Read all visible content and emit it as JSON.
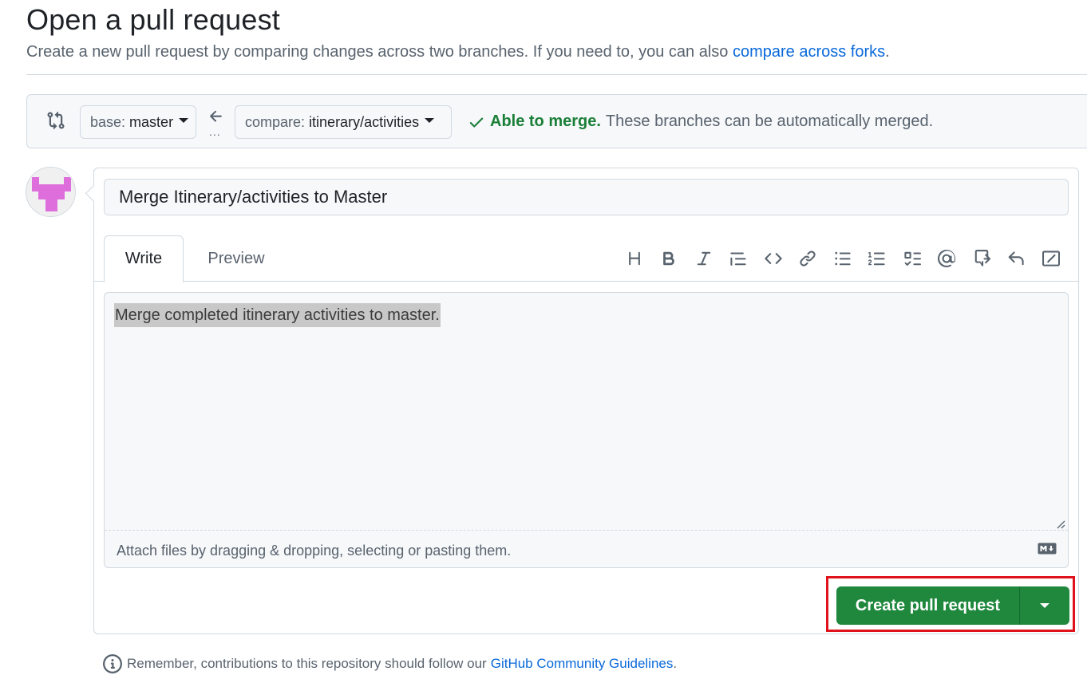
{
  "header": {
    "title": "Open a pull request",
    "subtitle_text": "Create a new pull request by comparing changes across two branches. If you need to, you can also",
    "subtitle_link": "compare across forks",
    "subtitle_end": "."
  },
  "range": {
    "base_prefix": "base:",
    "base_branch": "master",
    "compare_prefix": "compare:",
    "compare_branch": "itinerary/activities",
    "dots": "...",
    "merge_ok": "Able to merge.",
    "merge_note": "These branches can be automatically merged."
  },
  "form": {
    "title_value": "Merge Itinerary/activities to Master",
    "tabs": [
      {
        "label": "Write",
        "active": true
      },
      {
        "label": "Preview",
        "active": false
      }
    ],
    "toolbar_icons": [
      "heading-icon",
      "bold-icon",
      "italic-icon",
      "quote-icon",
      "code-icon",
      "link-icon",
      "unordered-list-icon",
      "ordered-list-icon",
      "task-list-icon",
      "mention-icon",
      "cross-reference-icon",
      "reply-icon",
      "slash-commands-icon"
    ],
    "body_text": "Merge completed itinerary activities to master.",
    "attach_text": "Attach files by dragging & dropping, selecting or pasting them.",
    "markdown_badge": "M↓"
  },
  "actions": {
    "create_label": "Create pull request"
  },
  "footer": {
    "text": "Remember, contributions to this repository should follow our",
    "link": "GitHub Community Guidelines",
    "end": "."
  },
  "colors": {
    "accent_link": "#0969da",
    "success": "#1a7f37",
    "primary_button": "#1f883d",
    "highlight_box": "#e0131c"
  }
}
